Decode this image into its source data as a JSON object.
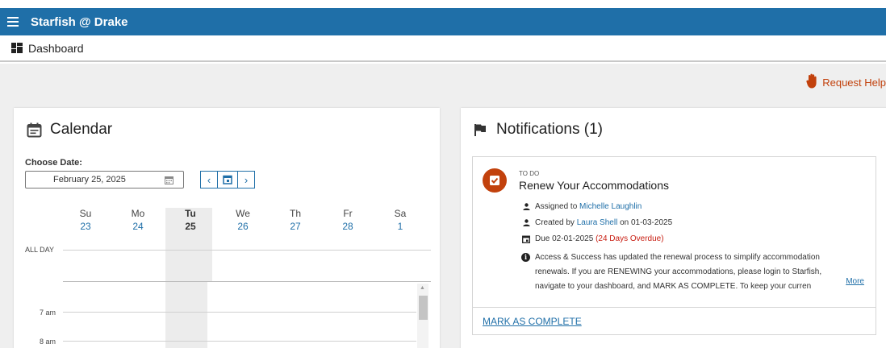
{
  "app": {
    "title": "Starfish @ Drake"
  },
  "page": {
    "title": "Dashboard"
  },
  "help": {
    "label": "Request Help"
  },
  "calendar": {
    "title": "Calendar",
    "choose_date_label": "Choose Date:",
    "date_value": "February 25, 2025",
    "days": [
      {
        "name": "Su",
        "num": "23"
      },
      {
        "name": "Mo",
        "num": "24"
      },
      {
        "name": "Tu",
        "num": "25"
      },
      {
        "name": "We",
        "num": "26"
      },
      {
        "name": "Th",
        "num": "27"
      },
      {
        "name": "Fr",
        "num": "28"
      },
      {
        "name": "Sa",
        "num": "1"
      }
    ],
    "all_day_label": "ALL DAY",
    "times": [
      "7 am",
      "8 am"
    ]
  },
  "notifications": {
    "title": "Notifications (1)",
    "item": {
      "kicker": "TO DO",
      "title": "Renew Your Accommodations",
      "assigned_prefix": "Assigned to",
      "assigned_name": "Michelle Laughlin",
      "created_prefix": "Created by",
      "created_name": "Laura Shell",
      "created_suffix": "on 01-03-2025",
      "due_text": "Due 02-01-2025",
      "overdue_text": "(24 Days Overdue)",
      "body_lines": [
        "Access & Success has updated the renewal process to simplify accommodation",
        "renewals. If you are RENEWING your accommodations, please login to Starfish,",
        "navigate to your dashboard, and MARK AS COMPLETE. To keep your curren"
      ],
      "more_label": "More",
      "action_label": "MARK AS COMPLETE"
    }
  },
  "colors": {
    "brand": "#1f6fa8",
    "accent": "#c2410c",
    "overdue": "#c81d11"
  }
}
